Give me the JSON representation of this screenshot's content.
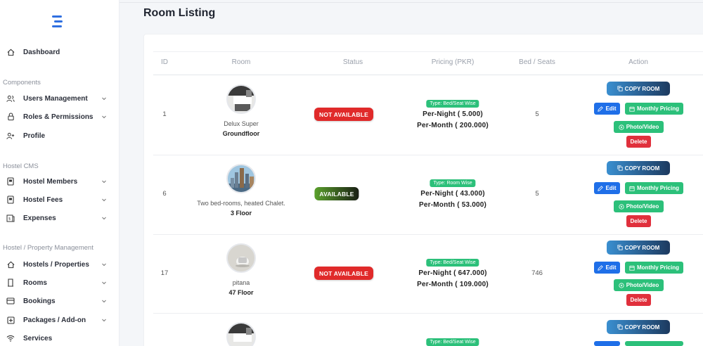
{
  "page": {
    "title": "Room Listing"
  },
  "sidebar": {
    "logo_icon": "logo-stack-icon",
    "items": [
      {
        "label": "Dashboard",
        "icon": "home-icon",
        "chevron": false
      },
      {
        "label": "Users Management",
        "icon": "users-icon",
        "chevron": true
      },
      {
        "label": "Roles & Permissions",
        "icon": "lock-icon",
        "chevron": true
      },
      {
        "label": "Profile",
        "icon": "user-plus-icon",
        "chevron": false
      },
      {
        "label": "Hostel Members",
        "icon": "id-card-icon",
        "chevron": true
      },
      {
        "label": "Hostel Fees",
        "icon": "id-card-icon",
        "chevron": true
      },
      {
        "label": "Expenses",
        "icon": "receipt-icon",
        "chevron": true
      },
      {
        "label": "Hostels / Properties",
        "icon": "home-icon",
        "chevron": true
      },
      {
        "label": "Rooms",
        "icon": "door-icon",
        "chevron": true
      },
      {
        "label": "Bookings",
        "icon": "card-icon",
        "chevron": true
      },
      {
        "label": "Packages / Add-on",
        "icon": "plus-square-icon",
        "chevron": true
      },
      {
        "label": "Services",
        "icon": "wifi-icon",
        "chevron": false
      }
    ],
    "sections": [
      "Components",
      "Hostel CMS",
      "Hostel / Property Management"
    ]
  },
  "table": {
    "headers": [
      "ID",
      "Room",
      "Status",
      "Pricing (PKR)",
      "Bed / Seats",
      "Action"
    ],
    "rows": [
      {
        "id": "1",
        "name": "Delux Super",
        "floor": "Groundfloor",
        "status": "NOT AVAILABLE",
        "type": "Type: Bed/Seat Wise",
        "night": "Per-Night ( 5.000)",
        "month": "Per-Month ( 200.000)",
        "beds": "5",
        "image": "room-interior"
      },
      {
        "id": "6",
        "name": "Two bed-rooms, heated Chalet.",
        "floor": "3 Floor",
        "status": "AVAILABLE",
        "type": "Type: Room Wise",
        "night": "Per-Night ( 43.000)",
        "month": "Per-Month ( 53.000)",
        "beds": "5",
        "image": "city-skyline"
      },
      {
        "id": "17",
        "name": "pitana",
        "floor": "47 Floor",
        "status": "NOT AVAILABLE",
        "type": "Type: Bed/Seat Wise",
        "night": "Per-Night ( 647.000)",
        "month": "Per-Month ( 109.000)",
        "beds": "746",
        "image": "object-photo"
      },
      {
        "id": "",
        "name": "",
        "floor": "",
        "status": "",
        "type": "Type: Bed/Seat Wise",
        "night": "",
        "month": "",
        "beds": "",
        "image": "room-interior"
      }
    ]
  },
  "actions": {
    "copy": "COPY ROOM",
    "edit": "Edit",
    "monthly": "Monthly Pricing",
    "photo": "Photo/Video",
    "delete": "Delete"
  },
  "colors": {
    "accent": "#2f6fe0",
    "available": "#5aa02c",
    "not_available": "#e02a2a",
    "green": "#2cc07a",
    "edit": "#1f6fe8",
    "delete": "#e0303c"
  }
}
